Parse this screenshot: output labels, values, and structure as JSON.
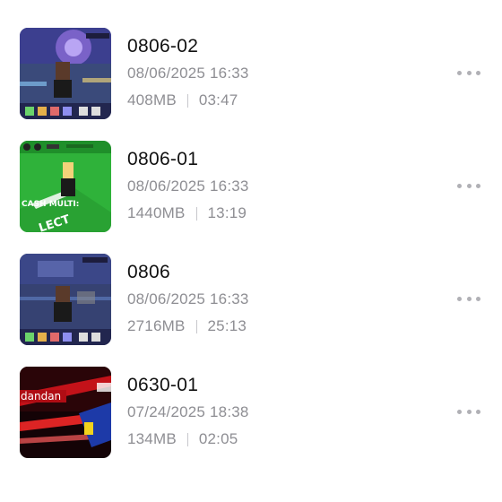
{
  "recordings": [
    {
      "title": "0806-02",
      "date": "08/06/2025 16:33",
      "size": "408MB",
      "duration": "03:47",
      "thumbnail_icon": "game-recording-thumbnail"
    },
    {
      "title": "0806-01",
      "date": "08/06/2025 16:33",
      "size": "1440MB",
      "duration": "13:19",
      "thumbnail_icon": "game-recording-thumbnail",
      "thumbnail_text": "CASH MULTI:"
    },
    {
      "title": "0806",
      "date": "08/06/2025 16:33",
      "size": "2716MB",
      "duration": "25:13",
      "thumbnail_icon": "game-recording-thumbnail"
    },
    {
      "title": "0630-01",
      "date": "07/24/2025 18:38",
      "size": "134MB",
      "duration": "02:05",
      "thumbnail_icon": "game-recording-thumbnail",
      "thumbnail_text": "dandan"
    }
  ],
  "more_icon": "more-horizontal-icon",
  "colors": {
    "title": "#111111",
    "secondary": "#8e8e93",
    "divider": "#c7c7cc",
    "more_dots": "#b0b0b5"
  }
}
